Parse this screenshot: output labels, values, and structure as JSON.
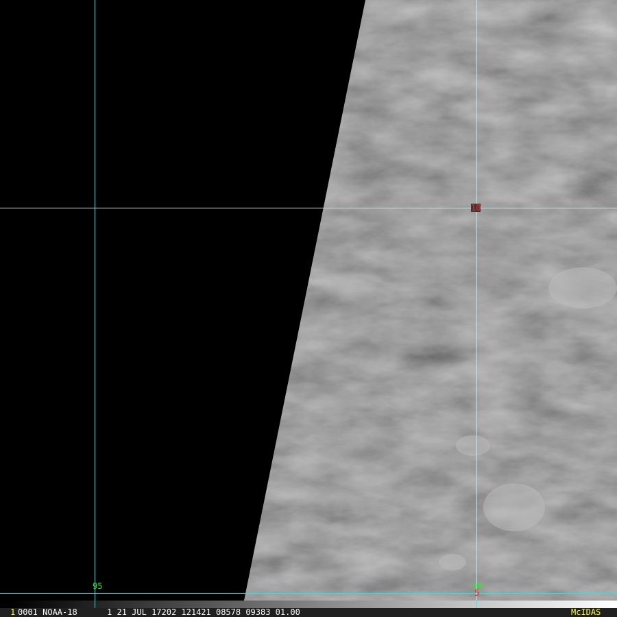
{
  "image": {
    "satellite": "NOAA-18",
    "swath_tone": "grayscale visible imagery",
    "colors": {
      "grid": "#33e0e0",
      "lon_label": "#22ee22",
      "lat_label": "#ff2020",
      "brand": "#ffff33",
      "background": "#000000"
    }
  },
  "grid": {
    "lon_labels": [
      "95",
      "90"
    ],
    "lat_labels": [
      "10",
      "5"
    ]
  },
  "status": {
    "frame_number": "1",
    "info": "0001 NOAA-18      1 21 JUL 17202 121421 08578 09383 01.00",
    "brand": "McIDAS"
  }
}
